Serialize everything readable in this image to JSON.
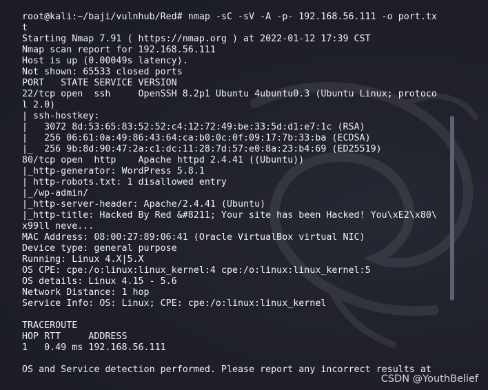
{
  "terminal": {
    "lines": [
      "root@kali:~/baji/vulnhub/Red# nmap -sC -sV -A -p- 192.168.56.111 -o port.tx",
      "t",
      "Starting Nmap 7.91 ( https://nmap.org ) at 2022-01-12 17:39 CST",
      "Nmap scan report for 192.168.56.111",
      "Host is up (0.00049s latency).",
      "Not shown: 65533 closed ports",
      "PORT   STATE SERVICE VERSION",
      "22/tcp open  ssh     OpenSSH 8.2p1 Ubuntu 4ubuntu0.3 (Ubuntu Linux; protoco",
      "l 2.0)",
      "| ssh-hostkey:",
      "|   3072 8d:53:65:83:52:52:c4:12:72:49:be:33:5d:d1:e7:1c (RSA)",
      "|   256 06:61:0a:49:86:43:64:ca:b0:0c:0f:09:17:7b:33:ba (ECDSA)",
      "|_  256 9b:8d:90:47:2a:c1:dc:11:28:7d:57:e0:8a:23:b4:69 (ED25519)",
      "80/tcp open  http    Apache httpd 2.4.41 ((Ubuntu))",
      "|_http-generator: WordPress 5.8.1",
      "| http-robots.txt: 1 disallowed entry",
      "|_/wp-admin/",
      "|_http-server-header: Apache/2.4.41 (Ubuntu)",
      "|_http-title: Hacked By Red &#8211; Your site has been Hacked! You\\xE2\\x80\\",
      "x99ll neve...",
      "MAC Address: 08:00:27:89:06:41 (Oracle VirtualBox virtual NIC)",
      "Device type: general purpose",
      "Running: Linux 4.X|5.X",
      "OS CPE: cpe:/o:linux:linux_kernel:4 cpe:/o:linux:linux_kernel:5",
      "OS details: Linux 4.15 - 5.6",
      "Network Distance: 1 hop",
      "Service Info: OS: Linux; CPE: cpe:/o:linux:linux_kernel",
      "",
      "TRACEROUTE",
      "HOP RTT     ADDRESS",
      "1   0.49 ms 192.168.56.111",
      "",
      "OS and Service detection performed. Please report any incorrect results at"
    ]
  },
  "watermark": "CSDN @YouthBelief",
  "colors": {
    "background": "#1e1f29",
    "text": "#f2f2f2",
    "scrollbar": "#5f6170"
  }
}
